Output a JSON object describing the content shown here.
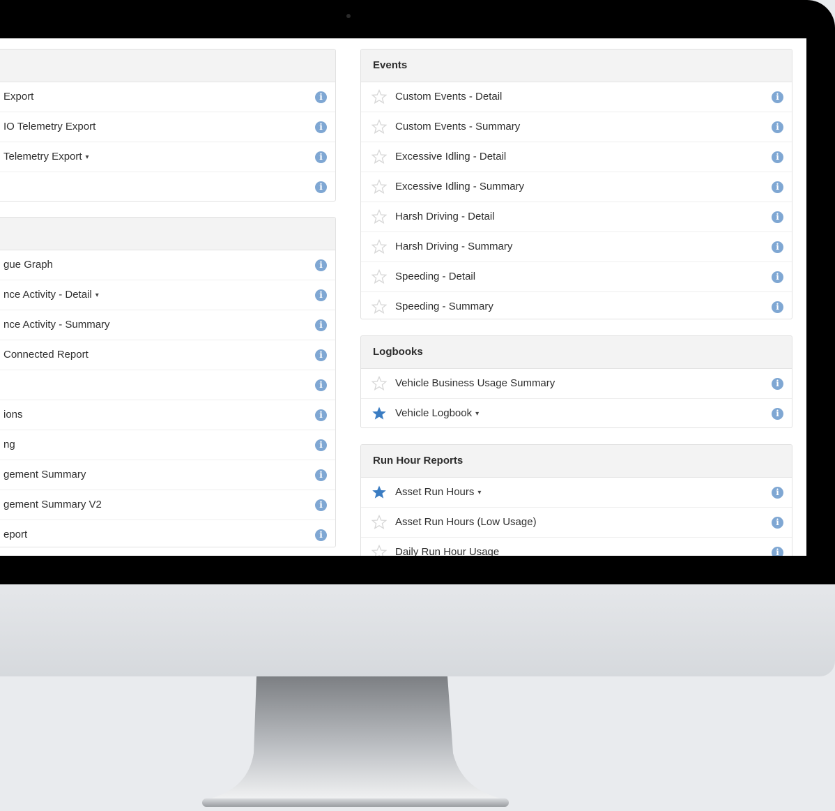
{
  "left_panel_top": {
    "rows": [
      {
        "label": "Export",
        "caret": ""
      },
      {
        "label": "IO Telemetry Export",
        "caret": ""
      },
      {
        "label": "Telemetry Export",
        "caret": "▾"
      },
      {
        "label": "",
        "caret": ""
      }
    ]
  },
  "left_panel_bottom": {
    "rows": [
      {
        "label": "gue Graph",
        "caret": ""
      },
      {
        "label": "nce Activity - Detail",
        "caret": "▾"
      },
      {
        "label": "nce Activity - Summary",
        "caret": ""
      },
      {
        "label": "Connected Report",
        "caret": ""
      },
      {
        "label": "",
        "caret": ""
      },
      {
        "label": "ions",
        "caret": ""
      },
      {
        "label": "ng",
        "caret": ""
      },
      {
        "label": "gement Summary",
        "caret": ""
      },
      {
        "label": "gement Summary V2",
        "caret": ""
      },
      {
        "label": "eport",
        "caret": ""
      }
    ]
  },
  "events": {
    "title": "Events",
    "rows": [
      {
        "label": "Custom Events - Detail",
        "starred": false,
        "caret": ""
      },
      {
        "label": "Custom Events - Summary",
        "starred": false,
        "caret": ""
      },
      {
        "label": "Excessive Idling - Detail",
        "starred": false,
        "caret": ""
      },
      {
        "label": "Excessive Idling - Summary",
        "starred": false,
        "caret": ""
      },
      {
        "label": "Harsh Driving - Detail",
        "starred": false,
        "caret": ""
      },
      {
        "label": "Harsh Driving - Summary",
        "starred": false,
        "caret": ""
      },
      {
        "label": "Speeding - Detail",
        "starred": false,
        "caret": ""
      },
      {
        "label": "Speeding - Summary",
        "starred": false,
        "caret": ""
      }
    ]
  },
  "logbooks": {
    "title": "Logbooks",
    "rows": [
      {
        "label": "Vehicle Business Usage Summary",
        "starred": false,
        "caret": ""
      },
      {
        "label": "Vehicle Logbook",
        "starred": true,
        "caret": "▾"
      }
    ]
  },
  "run_hours": {
    "title": "Run Hour Reports",
    "rows": [
      {
        "label": "Asset Run Hours",
        "starred": true,
        "caret": "▾"
      },
      {
        "label": "Asset Run Hours (Low Usage)",
        "starred": false,
        "caret": ""
      },
      {
        "label": "Daily Run Hour Usage",
        "starred": false,
        "caret": ""
      }
    ]
  },
  "icons": {
    "star": "star-icon",
    "info": "info-icon"
  },
  "colors": {
    "star_active": "#3a7cc2",
    "star_inactive": "#d6d6d6",
    "info": "#7fa7d3",
    "header_bg": "#f3f3f3"
  }
}
